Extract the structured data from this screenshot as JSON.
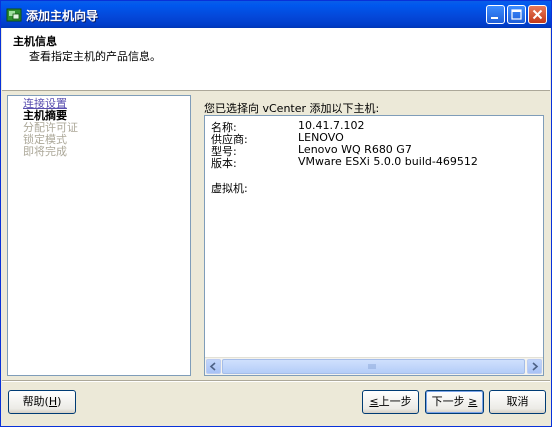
{
  "window": {
    "title": "添加主机向导"
  },
  "header": {
    "title": "主机信息",
    "subtitle": "查看指定主机的产品信息。"
  },
  "steps": [
    {
      "label": "连接设置",
      "state": "link"
    },
    {
      "label": "主机摘要",
      "state": "current"
    },
    {
      "label": "分配许可证",
      "state": "disabled"
    },
    {
      "label": "锁定模式",
      "state": "disabled"
    },
    {
      "label": "即将完成",
      "state": "disabled"
    }
  ],
  "summary": {
    "heading": "您已选择向 vCenter 添加以下主机:",
    "rows": [
      {
        "label": "名称:",
        "value": "10.41.7.102"
      },
      {
        "label": "供应商:",
        "value": "LENOVO"
      },
      {
        "label": "型号:",
        "value": "Lenovo WQ R680 G7"
      },
      {
        "label": "版本:",
        "value": "VMware ESXi 5.0.0 build-469512"
      }
    ],
    "vm_label": "虚拟机:"
  },
  "buttons": {
    "help": {
      "text": "帮助(",
      "key": "H",
      "end": ")"
    },
    "back": {
      "key": "≤",
      "text": "上一步"
    },
    "next": {
      "text": "下一步 ",
      "key": "≥"
    },
    "cancel": "取消"
  },
  "colors": {
    "titlebar": "#0447d8",
    "dialog_bg": "#ece9d8",
    "link": "#5a4fb0",
    "disabled": "#aca899"
  }
}
